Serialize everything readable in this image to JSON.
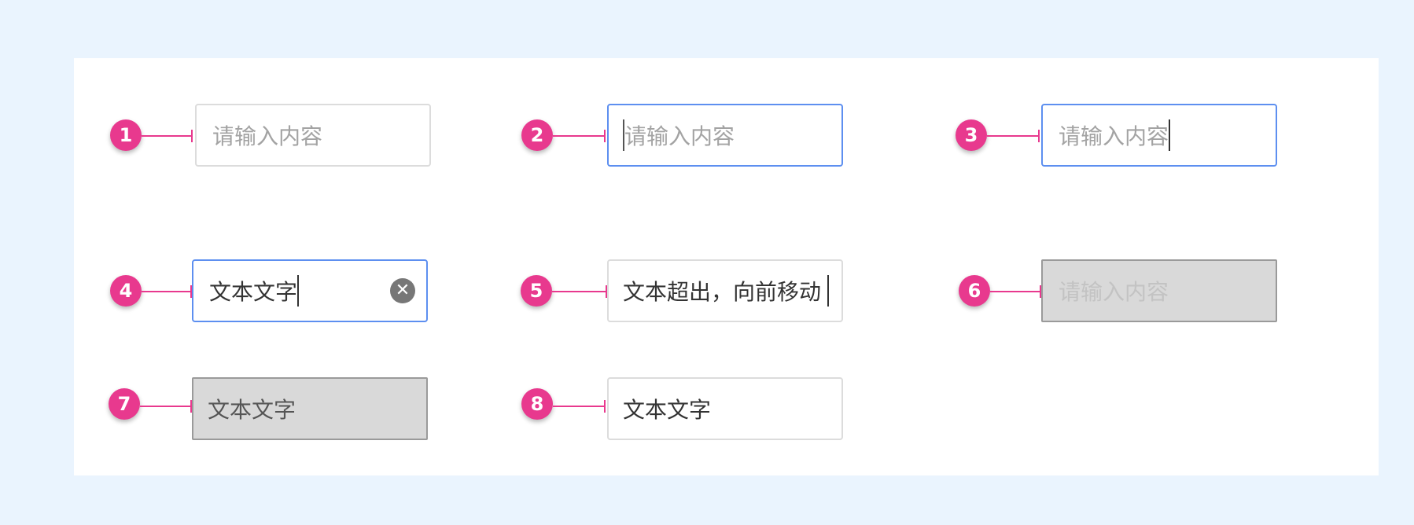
{
  "callouts": [
    "1",
    "2",
    "3",
    "4",
    "5",
    "6",
    "7",
    "8"
  ],
  "fields": {
    "default": {
      "placeholder": "请输入内容"
    },
    "focus_start": {
      "placeholder": "请输入内容"
    },
    "focus_end": {
      "placeholder": "请输入内容"
    },
    "typing": {
      "value": "文本文字",
      "clear_icon": "✕"
    },
    "overflow": {
      "value": "文本超出，向前移动"
    },
    "disabled_empty": {
      "placeholder": "请输入内容"
    },
    "disabled_filled": {
      "value": "文本文字"
    },
    "filled": {
      "value": "文本文字"
    }
  },
  "colors": {
    "background": "#eaf4fe",
    "callout": "#e8398e",
    "focus_border": "#5d8ff0",
    "disabled_fill": "#d9d9d9"
  }
}
